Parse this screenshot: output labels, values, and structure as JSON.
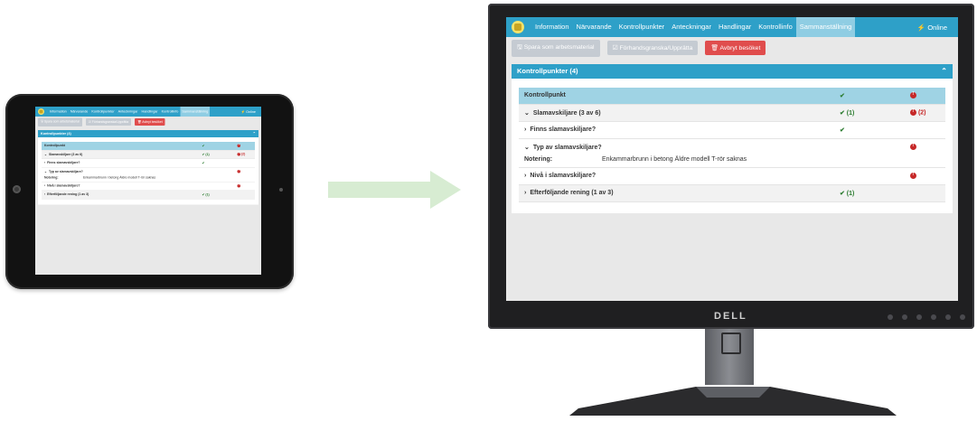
{
  "app": {
    "nav": {
      "items": [
        "Information",
        "Närvarande",
        "Kontrollpunkter",
        "Anteckningar",
        "Handlingar",
        "Kontrollinfo",
        "Sammanställning"
      ],
      "active_index": 6,
      "online": "⚡ Online"
    },
    "toolbar": {
      "save_template": "Spara som arbetsmaterial",
      "create_form": "Förhandsgranska/Upprätta",
      "cancel_visit": "Avbryt besöket"
    },
    "panel": {
      "title": "Kontrollpunkter (4)",
      "rows": [
        {
          "label": "Kontrollpunkt",
          "ok": "✔",
          "err": "!",
          "style": "head"
        },
        {
          "label": "Slamavskiljare (3 av 6)",
          "ok": "✔ (1)",
          "err": "! (2)",
          "style": "sub",
          "chevron": "⌄"
        },
        {
          "label": "Finns slamavskiljare?",
          "ok": "✔",
          "err": "",
          "style": "plain",
          "chevron": "›"
        },
        {
          "label": "Typ av slamavskiljare?",
          "ok": "",
          "err": "!",
          "style": "plain",
          "chevron": "⌄",
          "note_key": "Notering:",
          "note_value": "Enkammarbrunn i betong Äldre modell T-rör saknas"
        },
        {
          "label": "Nivå i slamavskiljare?",
          "ok": "",
          "err": "!",
          "style": "plain",
          "chevron": "›"
        },
        {
          "label": "Efterföljande rening (1 av 3)",
          "ok": "✔ (1)",
          "err": "",
          "style": "sub",
          "chevron": "›"
        }
      ]
    }
  },
  "monitor": {
    "brand": "DELL"
  },
  "colors": {
    "primary": "#2ea0c8",
    "active_tab": "#8fcde3",
    "danger": "#e04d4d",
    "ok": "#2e7d32",
    "arrow": "#d7ecd2"
  }
}
